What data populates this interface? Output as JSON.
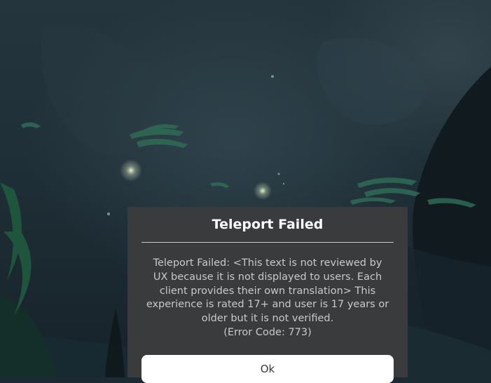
{
  "background": {
    "scene": "underwater cave game world, dark teal tones",
    "colors": {
      "water": "#1f2f37",
      "kelp": "#2f6b55",
      "rock": "#141c21",
      "sparkle": "#e8f3d8"
    }
  },
  "dialog": {
    "title": "Teleport Failed",
    "message": "Teleport Failed: <This text is not reviewed by UX because it is not displayed to users. Each client provides their own translation> This experience is rated 17+ and user is 17 years or older but it is not verified.",
    "error_code": "(Error Code: 773)",
    "ok_label": "Ok",
    "colors": {
      "panel": "#393b3d",
      "title": "#ffffff",
      "body": "#c9c9c9",
      "button": "#ffffff",
      "button_text": "#393b3d"
    }
  }
}
